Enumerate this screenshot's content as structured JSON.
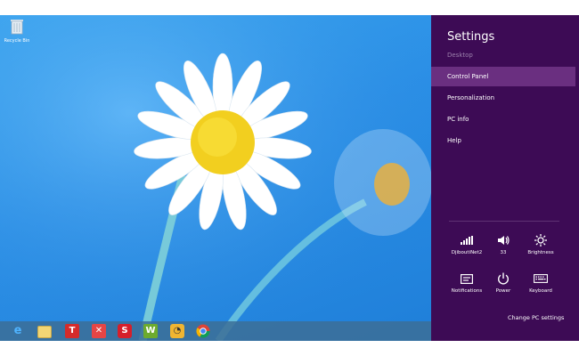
{
  "desktop": {
    "recycle_bin_label": "Recycle Bin"
  },
  "taskbar": {
    "items": [
      "internet-explorer",
      "file-explorer",
      "t-app",
      "red-app",
      "s-app",
      "w-app",
      "gauge-app",
      "chrome"
    ]
  },
  "charm": {
    "title": "Settings",
    "subtitle": "Desktop",
    "menu": [
      {
        "label": "Control Panel",
        "active": true
      },
      {
        "label": "Personalization",
        "active": false
      },
      {
        "label": "PC info",
        "active": false
      },
      {
        "label": "Help",
        "active": false
      }
    ],
    "tiles": [
      {
        "label": "DjiboutiNet2",
        "icon": "signal-icon"
      },
      {
        "label": "33",
        "icon": "volume-icon"
      },
      {
        "label": "Brightness",
        "icon": "brightness-icon"
      },
      {
        "label": "Notifications",
        "icon": "notifications-icon"
      },
      {
        "label": "Power",
        "icon": "power-icon"
      },
      {
        "label": "Keyboard",
        "icon": "keyboard-icon"
      }
    ],
    "change_pc_settings": "Change PC settings"
  },
  "colors": {
    "charm_bg": "#3d0b55",
    "charm_active": "#6a2f80",
    "desktop_blue": "#2b8fe6"
  }
}
